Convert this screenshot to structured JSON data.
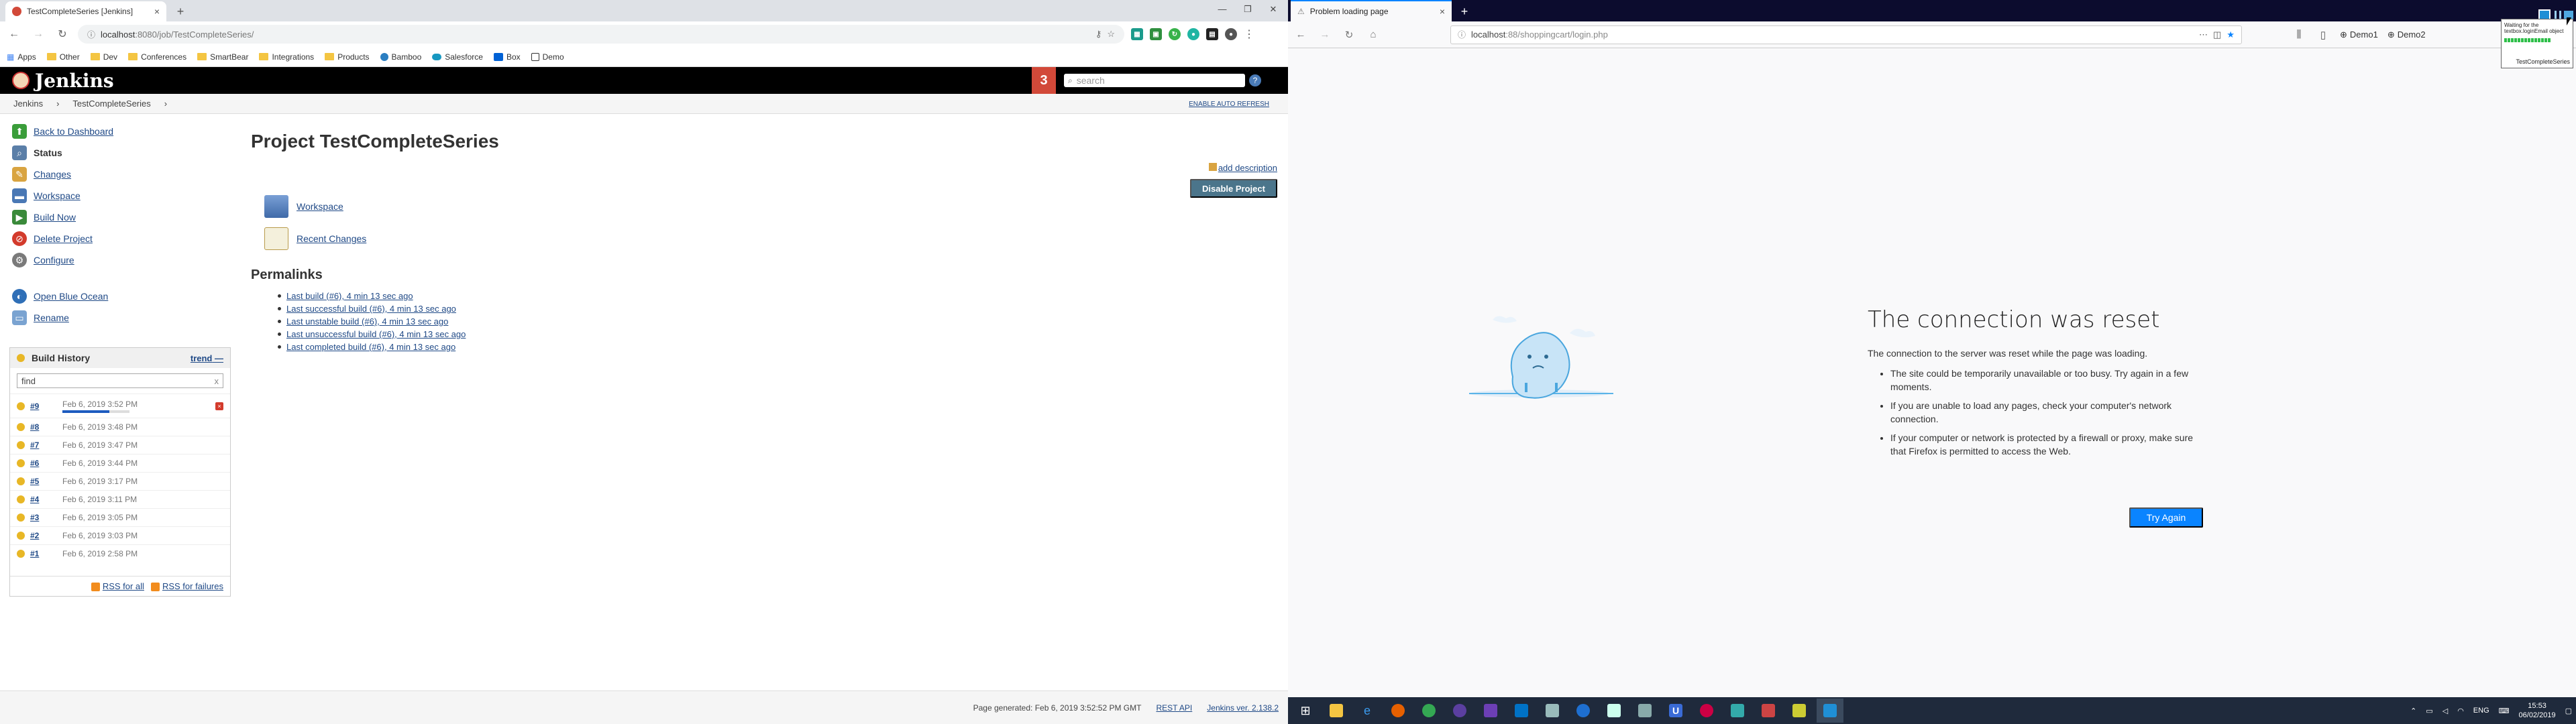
{
  "chrome": {
    "tab_title": "TestCompleteSeries [Jenkins]",
    "url_host": "localhost",
    "url_path": ":8080/job/TestCompleteSeries/",
    "bookmarks": [
      "Apps",
      "Other",
      "Dev",
      "Conferences",
      "SmartBear",
      "Integrations",
      "Products",
      "Bamboo",
      "Salesforce",
      "Box",
      "Demo"
    ]
  },
  "jenkins": {
    "logo_text": "Jenkins",
    "notification_count": "3",
    "search_placeholder": "search",
    "help_glyph": "?",
    "breadcrumb": [
      "Jenkins",
      "TestCompleteSeries"
    ],
    "auto_refresh": "ENABLE AUTO REFRESH",
    "tasks": [
      {
        "label": "Back to Dashboard",
        "icon": "up-arrow-icon",
        "color": "#3a9d3a",
        "bold": false
      },
      {
        "label": "Status",
        "icon": "search-icon",
        "color": "#5b7fa8",
        "bold": true
      },
      {
        "label": "Changes",
        "icon": "notepad-icon",
        "color": "#d9a441",
        "bold": false
      },
      {
        "label": "Workspace",
        "icon": "folder-icon",
        "color": "#4a78b5",
        "bold": false
      },
      {
        "label": "Build Now",
        "icon": "clock-play-icon",
        "color": "#3a8a3a",
        "bold": false
      },
      {
        "label": "Delete Project",
        "icon": "no-entry-icon",
        "color": "#d33b2c",
        "bold": false
      },
      {
        "label": "Configure",
        "icon": "gear-icon",
        "color": "#7a7a7a",
        "bold": false
      }
    ],
    "extras": [
      {
        "label": "Open Blue Ocean",
        "icon": "blue-ocean-icon",
        "color": "#2f6fb7"
      },
      {
        "label": "Rename",
        "icon": "rename-icon",
        "color": "#7aa3d1"
      }
    ],
    "build_history": {
      "title": "Build History",
      "trend": "trend",
      "trend_glyph": "—",
      "find_value": "find",
      "find_clear": "x",
      "builds": [
        {
          "num": "#9",
          "date": "Feb 6, 2019 3:52 PM",
          "progress": 0.7
        },
        {
          "num": "#8",
          "date": "Feb 6, 2019 3:48 PM"
        },
        {
          "num": "#7",
          "date": "Feb 6, 2019 3:47 PM"
        },
        {
          "num": "#6",
          "date": "Feb 6, 2019 3:44 PM"
        },
        {
          "num": "#5",
          "date": "Feb 6, 2019 3:17 PM"
        },
        {
          "num": "#4",
          "date": "Feb 6, 2019 3:11 PM"
        },
        {
          "num": "#3",
          "date": "Feb 6, 2019 3:05 PM"
        },
        {
          "num": "#2",
          "date": "Feb 6, 2019 3:03 PM"
        },
        {
          "num": "#1",
          "date": "Feb 6, 2019 2:58 PM"
        }
      ],
      "rss_all": "RSS for all",
      "rss_failures": "RSS for failures"
    },
    "project_title": "Project TestCompleteSeries",
    "add_description": "add description",
    "disable_project": "Disable Project",
    "workspace_link": "Workspace",
    "recent_changes_link": "Recent Changes",
    "permalinks_heading": "Permalinks",
    "permalinks": [
      "Last build (#6), 4 min 13 sec ago",
      "Last successful build (#6), 4 min 13 sec ago",
      "Last unstable build (#6), 4 min 13 sec ago",
      "Last unsuccessful build (#6), 4 min 13 sec ago",
      "Last completed build (#6), 4 min 13 sec ago"
    ],
    "footer": {
      "generated": "Page generated: Feb 6, 2019 3:52:52 PM GMT",
      "rest_api": "REST API",
      "version": "Jenkins ver. 2.138.2"
    }
  },
  "firefox": {
    "tab_title": "Problem loading page",
    "url_host": "localhost",
    "url_path": ":88/shoppingcart/login.php",
    "toolbar_right": [
      "Demo1",
      "Demo2"
    ],
    "error": {
      "title": "The connection was reset",
      "intro": "The connection to the server was reset while the page was loading.",
      "bullets": [
        "The site could be temporarily unavailable or too busy. Try again in a few moments.",
        "If you are unable to load any pages, check your computer's network connection.",
        "If your computer or network is protected by a firewall or proxy, make sure that Firefox is permitted to access the Web."
      ],
      "button": "Try Again"
    }
  },
  "testcomplete": {
    "waiting_text": "Waiting for the textbox.loginEmail object",
    "project": "TestCompleteSeries"
  },
  "taskbar": {
    "lang": "ENG",
    "time": "15:53",
    "date": "06/02/2019"
  }
}
